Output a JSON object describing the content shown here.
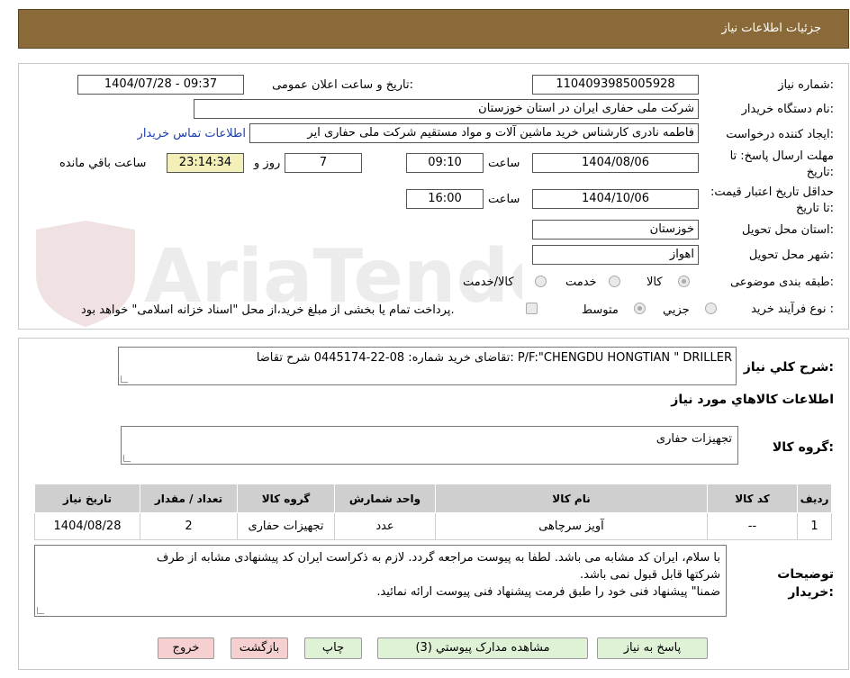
{
  "header": {
    "title": "جزئیات اطلاعات نیاز"
  },
  "form": {
    "need_number_label": "شماره نیاز:",
    "need_number": "1104093985005928",
    "announce_label": "تاریخ و ساعت اعلان عمومی:",
    "announce_value": "1404/07/28 - 09:37",
    "buyer_org_label": "نام دستگاه خریدار:",
    "buyer_org": "شرکت ملی حفاری ایران در استان خوزستان",
    "requester_label": "ایجاد کننده درخواست:",
    "requester": "فاطمه نادری کارشناس خرید ماشین آلات و مواد مستقیم شرکت ملی حفاری ایر",
    "contact_link": "اطلاعات تماس خریدار",
    "reply_deadline_label": "مهلت ارسال پاسخ: تا تاریخ:",
    "reply_date": "1404/08/06",
    "time_label": "ساعت",
    "reply_time": "09:10",
    "days_value": "7",
    "days_label": "روز و",
    "remaining_value": "23:14:34",
    "remaining_label": "ساعت باقي مانده",
    "price_validity_label": "حداقل تاریخ اعتبار قیمت: تا تاریخ:",
    "price_date": "1404/10/06",
    "price_time": "16:00",
    "province_label": "استان محل تحویل:",
    "province": "خوزستان",
    "city_label": "شهر محل تحویل:",
    "city": "اهواز",
    "category_label": "طبقه بندی موضوعی:",
    "category_options": [
      "کالا",
      "خدمت",
      "کالا/خدمت"
    ],
    "category_selected": "کالا",
    "process_label": "نوع فرآیند خرید :",
    "process_options": [
      "جزیي",
      "متوسط"
    ],
    "process_selected": "متوسط",
    "payment_note": "پرداخت تمام یا بخشی از مبلغ خرید،از محل \"اسناد خزانه اسلامی\" خواهد بود."
  },
  "summary": {
    "label": "شرح کلي نیاز:",
    "text": "تقاضای خرید شماره:  08-22-0445174 شرح تقاضا: P/F:\"CHENGDU HONGTIAN \" DRILLER"
  },
  "goods_section": {
    "title": "اطلاعات کالاهاي مورد نیاز"
  },
  "goods_group": {
    "label": "گروه کالا:",
    "value": "تجهیزات حفاری"
  },
  "table": {
    "headers": [
      "ردیف",
      "کد کالا",
      "نام کالا",
      "واحد شمارش",
      "گروه کالا",
      "تعداد / مقدار",
      "تاریخ نیاز"
    ],
    "rows": [
      [
        "1",
        "--",
        "آویز سرچاهی",
        "عدد",
        "تجهیزات حفاری",
        "2",
        "1404/08/28"
      ]
    ]
  },
  "buyer_notes": {
    "label": "توضیحات خریدار:",
    "line1": "با سلام، ایران کد مشابه می باشد. لطفا به پیوست مراجعه گردد. لازم به ذکراست ایران کد پیشنهادی مشابه از طرف",
    "line2": "شرکتها قابل قبول نمی باشد.",
    "line3": "ضمنا\" پیشنهاد فنی خود را طبق فرمت پیشنهاد فنی پیوست ارائه نمائید."
  },
  "buttons": {
    "reply": "پاسخ به نیاز",
    "attachments": "مشاهده مدارک پیوستي (3)",
    "print": "چاپ",
    "back": "بازگشت",
    "exit": "خروج"
  },
  "watermark": {
    "text": "AriaTender.neT"
  },
  "colors": {
    "header_bg": "#8b6a3a",
    "highlight": "#f3efb8",
    "link": "#1a3fb0",
    "button_green": "#dff2d6",
    "button_pink": "#f6d0d0"
  }
}
